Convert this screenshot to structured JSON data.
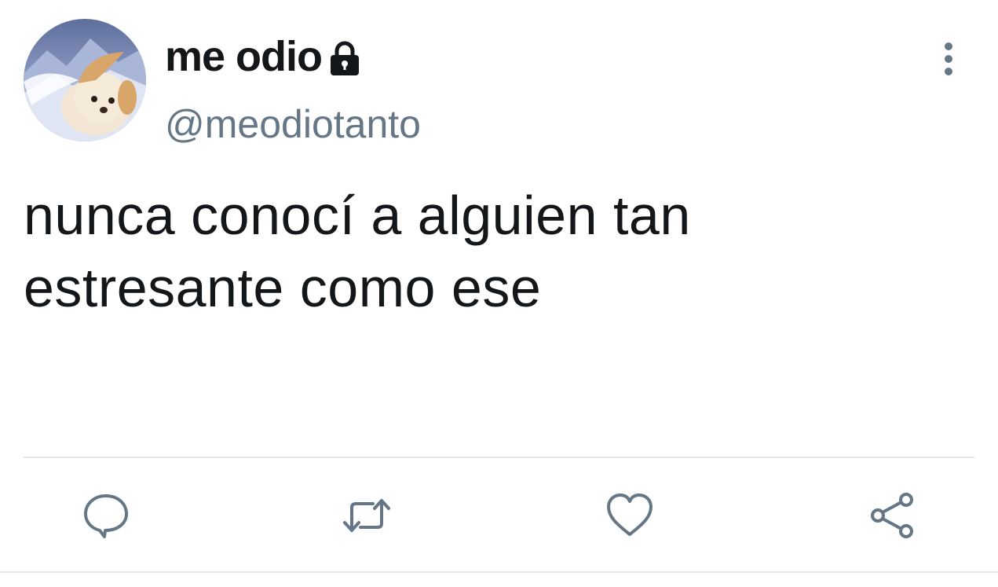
{
  "user": {
    "display_name": "me odio",
    "handle": "@meodiotanto",
    "protected": true,
    "avatar_icon": "puppy-avatar"
  },
  "tweet": {
    "text": "nunca conocí a alguien tan estresante como ese"
  },
  "actions": {
    "reply_icon": "comment-icon",
    "retweet_icon": "retweet-icon",
    "like_icon": "heart-icon",
    "share_icon": "share-icon",
    "more_icon": "vertical-dots-icon"
  },
  "colors": {
    "text_primary": "#14171a",
    "text_secondary": "#657786",
    "divider": "#e1e8ed",
    "icon": "#657786"
  }
}
